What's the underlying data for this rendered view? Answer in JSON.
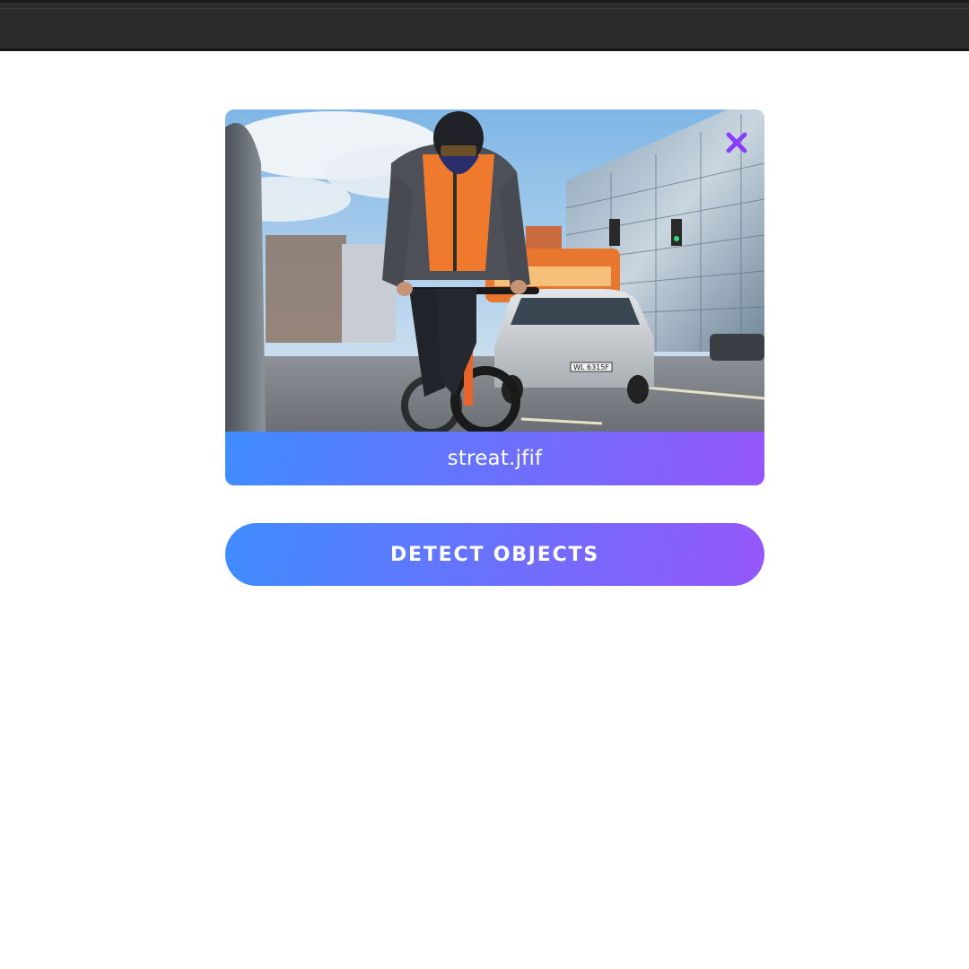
{
  "theme": {
    "gradient_start": "#3f8cff",
    "gradient_end": "#9556fa",
    "close_icon_color": "#8b3dff",
    "topbar_color": "#2b2b2b"
  },
  "upload": {
    "filename": "streat.jfif",
    "preview_icon": "street-photo-cyclist",
    "remove_icon": "close-icon",
    "plate_text": "WL 6315F"
  },
  "actions": {
    "detect_label": "DETECT OBJECTS"
  }
}
